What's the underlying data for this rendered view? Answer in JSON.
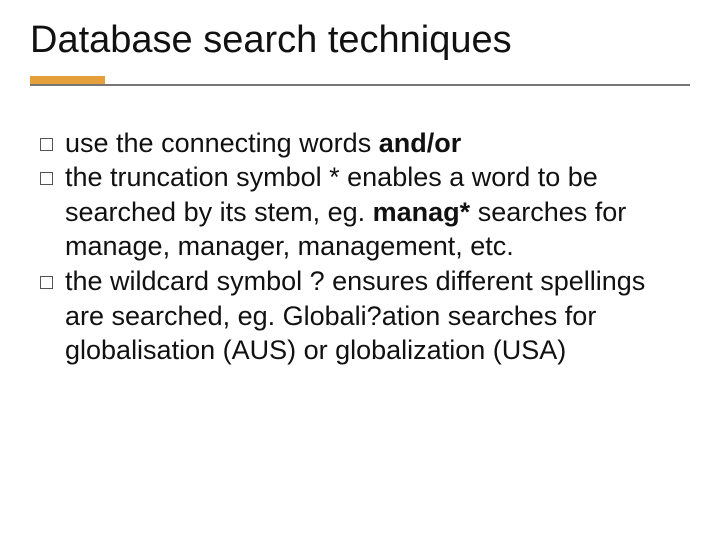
{
  "title": "Database search techniques",
  "bullets": [
    {
      "pre": "use the connecting words ",
      "bold": "and/or",
      "post": ""
    },
    {
      "pre": "the truncation symbol  *  enables a word to be searched by its stem, eg. ",
      "bold": "manag*",
      "post": "  searches for manage, manager, management, etc."
    },
    {
      "pre": "the wildcard symbol ? ensures different spellings are searched, eg. Globali?ation searches for globalisation (AUS) or globalization (USA)",
      "bold": "",
      "post": ""
    }
  ]
}
